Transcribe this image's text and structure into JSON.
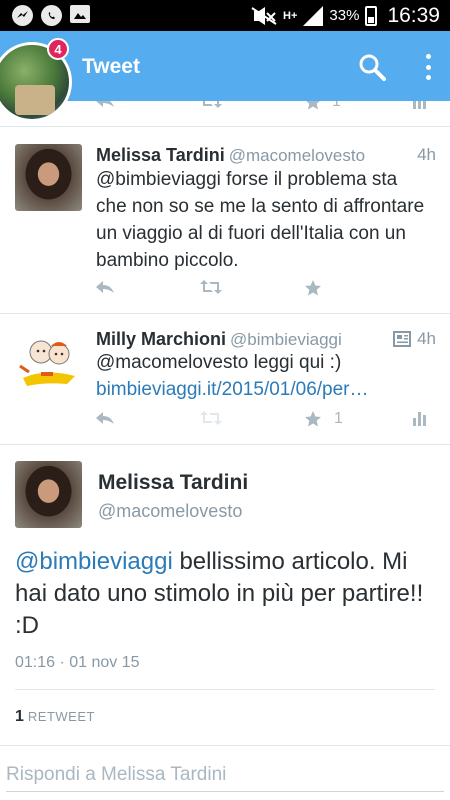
{
  "status_bar": {
    "network": "H+",
    "battery": "33%",
    "time": "16:39"
  },
  "header": {
    "title": "Tweet",
    "notification_count": "4"
  },
  "partial_actions": {
    "favorite_count": "1"
  },
  "tweets": [
    {
      "name": "Melissa Tardini",
      "handle": "@macomelovesto",
      "time": "4h",
      "text": "@bimbieviaggi forse il problema sta che non so se me la sento di affrontare un viaggio al di fuori dell'Italia con un bambino piccolo."
    },
    {
      "name": "Milly Marchioni",
      "handle": "@bimbieviaggi",
      "time": "4h",
      "text": "@macomelovesto leggi qui :)",
      "link": "bimbieviaggi.it/2015/01/06/per…",
      "favorite_count": "1"
    }
  ],
  "detail": {
    "name": "Melissa Tardini",
    "handle": "@macomelovesto",
    "mention": "@bimbieviaggi",
    "text": " bellissimo articolo. Mi hai dato uno stimolo in più per partire!! :D",
    "date": "01:16 · 01 nov 15",
    "retweet_count": "1",
    "retweet_label": "RETWEET"
  },
  "reply": {
    "placeholder": "Rispondi a Melissa Tardini"
  },
  "colors": {
    "header": "#55acee",
    "link": "#2b7bb9",
    "muted": "#8899a6",
    "icon": "#aab8c2",
    "badge": "#e0245e"
  },
  "icons": [
    "messenger-icon",
    "whatsapp-icon",
    "gallery-icon",
    "mute-icon",
    "signal-icon",
    "battery-icon",
    "search-icon",
    "more-vert-icon",
    "reply-icon",
    "retweet-icon",
    "favorite-icon",
    "stats-icon",
    "article-icon"
  ]
}
